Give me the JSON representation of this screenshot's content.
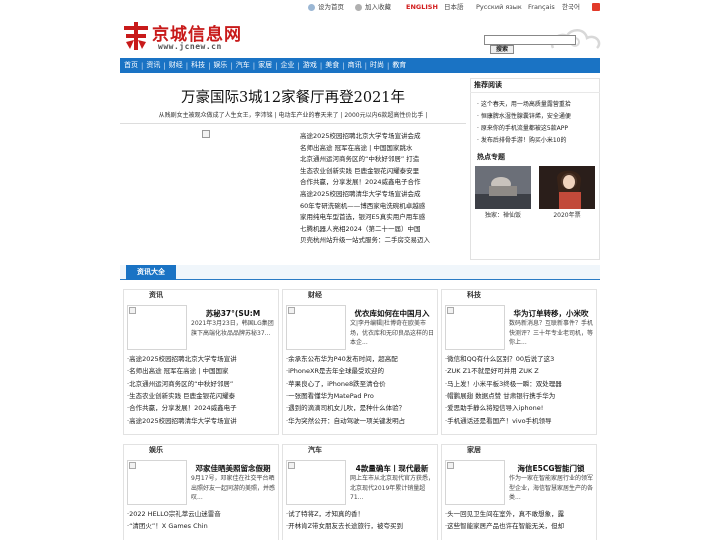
{
  "topbar": {
    "home": "设为首页",
    "fav": "加入收藏",
    "english": "ENGLISH",
    "japanese": "日本語",
    "russian": "Русский язык",
    "french": "Français",
    "korean": "한국어"
  },
  "header": {
    "logo_text": "京城信息网",
    "logo_url": "www.jcnew.cn",
    "search_button": "搜索"
  },
  "nav": [
    "首页",
    "资讯",
    "财经",
    "科技",
    "娱乐",
    "汽车",
    "家居",
    "企业",
    "游戏",
    "美食",
    "商讯",
    "时尚",
    "教育"
  ],
  "headline": {
    "title": "万豪国际3城12家餐厅再登2021年",
    "subline": "从贱剧女主被观众做成了人生女王，李沛铭 | 电动车产业的春天来了 | 2000元以内6款超高性价比手 |"
  },
  "headline_list": [
    "高途2025校园招聘北京大学专场宣讲会成",
    "名师出高途 冠军在高途 | 中国国家跳水",
    "北京通州运河商务区的“中秋好邻居” 打造",
    "生态农业创新实践 巨鹿金银花闪耀泰安里",
    "合作共赢，分享发展！2024威鑫电子合作",
    "高途2025校园招聘清华大学专场宣讲会成",
    "60年专研洗碗机——博西家电洗碗机卓越感",
    "家用纯电车型首选，银河E5真实用户用车感",
    "七腾机器人亮相2024（第二十一届）中国",
    "贝壳杭州站升级一站式服务：二手房交易迈入"
  ],
  "sidebar": {
    "recommend_title": "推荐阅读",
    "recommend_items": [
      "· 这个春天，用一场高质量露营重拾",
      "· 恒康脾水湿性腺囊锌烯，安全通便",
      "· 原来你的手机流量都被这5款APP",
      "· 发布后排骨手游！购买小米10的"
    ],
    "hot_title": "热点专题",
    "hot": [
      {
        "caption": "独家：禅仙饭"
      },
      {
        "caption": "2020年票"
      }
    ]
  },
  "section": {
    "title": "资讯大全"
  },
  "panels": [
    {
      "tag": "资讯",
      "title": "苏秘37°(SU:M",
      "desc": "2021年3月23日，韩国LG集团旗下高端化妆品品牌苏秘37...",
      "list": [
        "·高途2025校园招聘北京大学专场宣讲",
        "·名师出高途 冠军在高途 | 中国国家",
        "·北京通州运河商务区的“中秋好邻居”",
        "·生态农业创新实践 巨鹿金银花闪耀泰",
        "·合作共赢，分享发展！2024威鑫电子",
        "·高途2025校园招聘清华大学专场宣讲"
      ]
    },
    {
      "tag": "财经",
      "title": "优衣库如何在中国月入",
      "desc": "文|李丹编辑|杜博奇在欧美市场，优衣库和无印良品这样的日本企...",
      "list": [
        "·余承东公布华为P40发布时间，超高配",
        "·iPhoneXR是去年全球最受欢迎的",
        "·苹果良心了，iPhone8跌至清仓价",
        "·一张图看懂华为MatePad Pro",
        "·遇到的滴滴司机女儿吹，是种什么体验？",
        "·华为突然公开：自动驾驶一项关键发明占"
      ]
    },
    {
      "tag": "科技",
      "title": "华为订单转移，小米吹",
      "desc": "数码新消息？互联新事件？手机快测评？三十年专业老司机，等你上...",
      "list": [
        "·微信和QQ有什么区别？00后说了这3",
        "·ZUK Z1不就是好可并用 ZUK Z",
        "·马上发！小米平板3终极一瞬：双处理器",
        "·帽鹏展翅 数据点赞 甘肃银行携手华为",
        "·爱思助手静么将短信导入iphone!",
        "·手机通话还是看国产！vivo手机领导"
      ]
    },
    {
      "tag": "娱乐",
      "title": "邓家佳晒美照留念假期",
      "desc": "9月17号，邓家佳在社交平台晒出照好友一起同游的美照，并感叹...",
      "list": [
        "·2022 HELLO宗礼萃云山迷雷音",
        "·“清团火”！X Games Chin"
      ]
    },
    {
      "tag": "汽车",
      "title": "4款量确车丨现代最新",
      "desc": "网上车市从北京现代官方获悉，北京现代2019年累计销量超71...",
      "list": [
        "·试了特将Z，才知真的香！",
        "·开林肯Z带女朋友去长途旅行，被夸买到"
      ]
    },
    {
      "tag": "家居",
      "title": "海信E5CG智能门锁",
      "desc": "作为一家在智能家居行业的领军型企业，海信智慧家居生产的各类...",
      "list": [
        "·头一回见卫生间在室外，真不敢想象，露",
        "·这些智能家居产品也许在智能无关，但却"
      ]
    }
  ],
  "colors": {
    "nav_blue": "#1a73c4",
    "logo_red": "#c81a1a",
    "english_red": "#d21c1c"
  }
}
